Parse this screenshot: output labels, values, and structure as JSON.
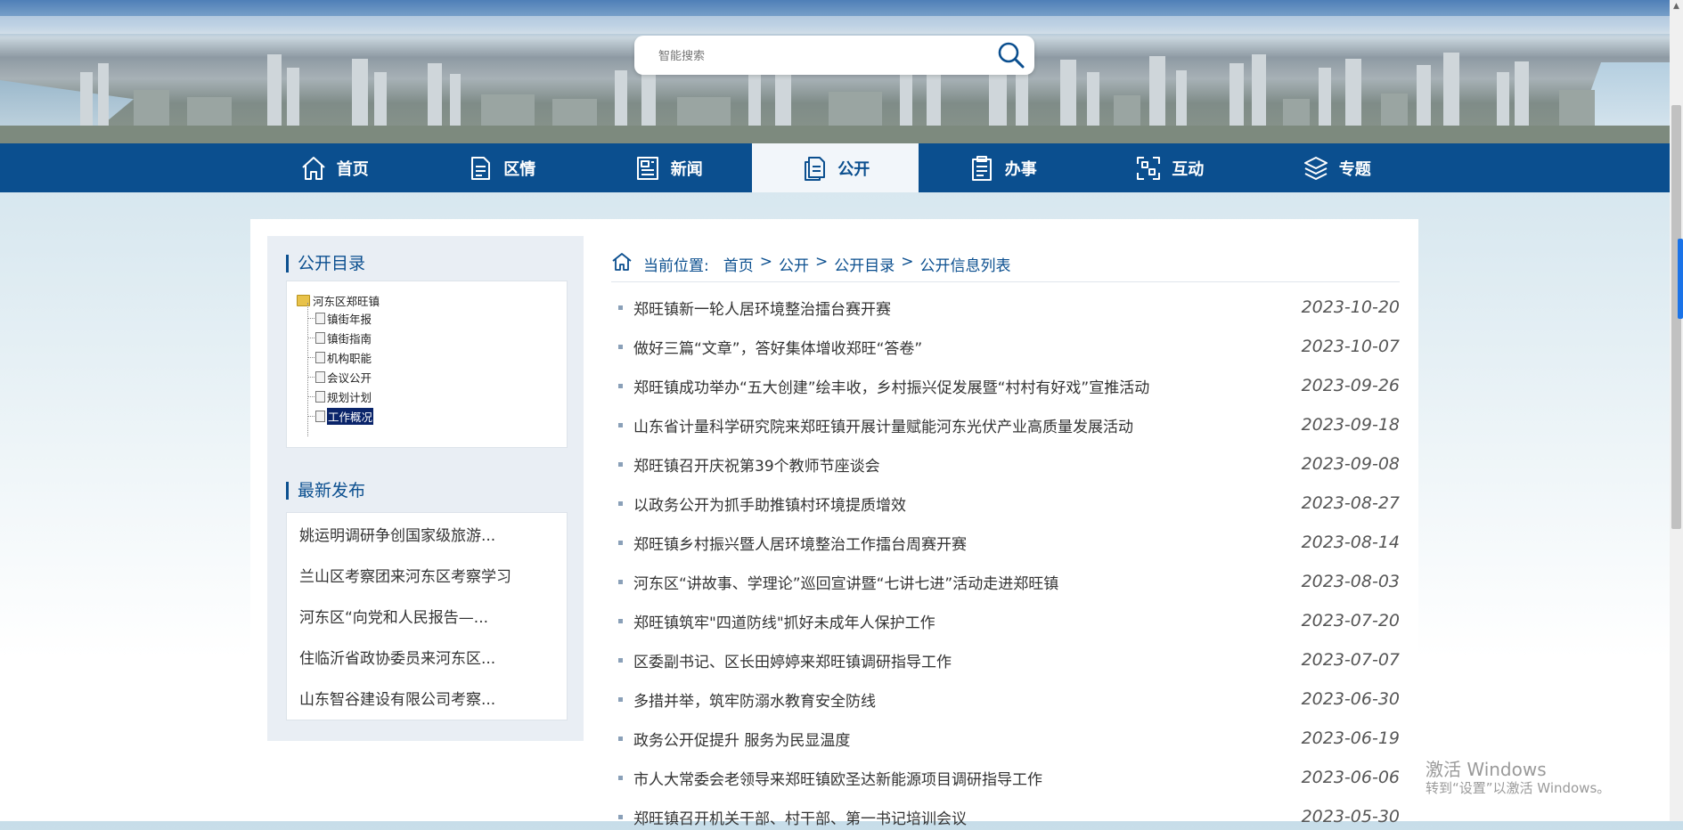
{
  "search": {
    "placeholder": "智能搜索"
  },
  "nav": {
    "items": [
      {
        "label": "首页",
        "icon": "home-icon"
      },
      {
        "label": "区情",
        "icon": "document-icon"
      },
      {
        "label": "新闻",
        "icon": "newspaper-icon"
      },
      {
        "label": "公开",
        "icon": "file-copy-icon",
        "active": true
      },
      {
        "label": "办事",
        "icon": "clipboard-icon"
      },
      {
        "label": "互动",
        "icon": "scan-icon"
      },
      {
        "label": "专题",
        "icon": "layers-icon"
      }
    ]
  },
  "sidebar": {
    "catalog_title": "公开目录",
    "tree": {
      "root": "河东区郑旺镇",
      "items": [
        "镇街年报",
        "镇街指南",
        "机构职能",
        "会议公开",
        "规划计划",
        "工作概况"
      ],
      "selected": "工作概况"
    },
    "latest_title": "最新发布",
    "latest": [
      "姚运明调研争创国家级旅游...",
      "兰山区考察团来河东区考察学习",
      "河东区“向党和人民报告—...",
      "住临沂省政协委员来河东区...",
      "山东智谷建设有限公司考察..."
    ]
  },
  "breadcrumb": {
    "label": "当前位置:",
    "crumbs": [
      "首页",
      "公开",
      "公开目录",
      "公开信息列表"
    ],
    "separator": ">"
  },
  "articles": [
    {
      "title": "郑旺镇新一轮人居环境整治擂台赛开赛",
      "date": "2023-10-20"
    },
    {
      "title": "做好三篇“文章”，答好集体增收郑旺“答卷”",
      "date": "2023-10-07"
    },
    {
      "title": "郑旺镇成功举办“五大创建”绘丰收，乡村振兴促发展暨“村村有好戏”宣推活动",
      "date": "2023-09-26"
    },
    {
      "title": "山东省计量科学研究院来郑旺镇开展计量赋能河东光伏产业高质量发展活动",
      "date": "2023-09-18"
    },
    {
      "title": "郑旺镇召开庆祝第39个教师节座谈会",
      "date": "2023-09-08"
    },
    {
      "title": "以政务公开为抓手助推镇村环境提质增效",
      "date": "2023-08-27"
    },
    {
      "title": "郑旺镇乡村振兴暨人居环境整治工作擂台周赛开赛",
      "date": "2023-08-14"
    },
    {
      "title": "河东区“讲故事、学理论”巡回宣讲暨“七讲七进”活动走进郑旺镇",
      "date": "2023-08-03"
    },
    {
      "title": "郑旺镇筑牢\"四道防线\"抓好未成年人保护工作",
      "date": "2023-07-20"
    },
    {
      "title": "区委副书记、区长田婷婷来郑旺镇调研指导工作",
      "date": "2023-07-07"
    },
    {
      "title": "多措并举，筑牢防溺水教育安全防线",
      "date": "2023-06-30"
    },
    {
      "title": "政务公开促提升 服务为民显温度",
      "date": "2023-06-19"
    },
    {
      "title": "市人大常委会老领导来郑旺镇欧圣达新能源项目调研指导工作",
      "date": "2023-06-06"
    },
    {
      "title": "郑旺镇召开机关干部、村干部、第一书记培训会议",
      "date": "2023-05-30"
    }
  ],
  "watermark": {
    "line1": "激活 Windows",
    "line2": "转到“设置”以激活 Windows。"
  },
  "colors": {
    "nav_bg": "#0b4f8f",
    "nav_active_bg": "#f2f6fa",
    "accent": "#0b4f8f"
  }
}
